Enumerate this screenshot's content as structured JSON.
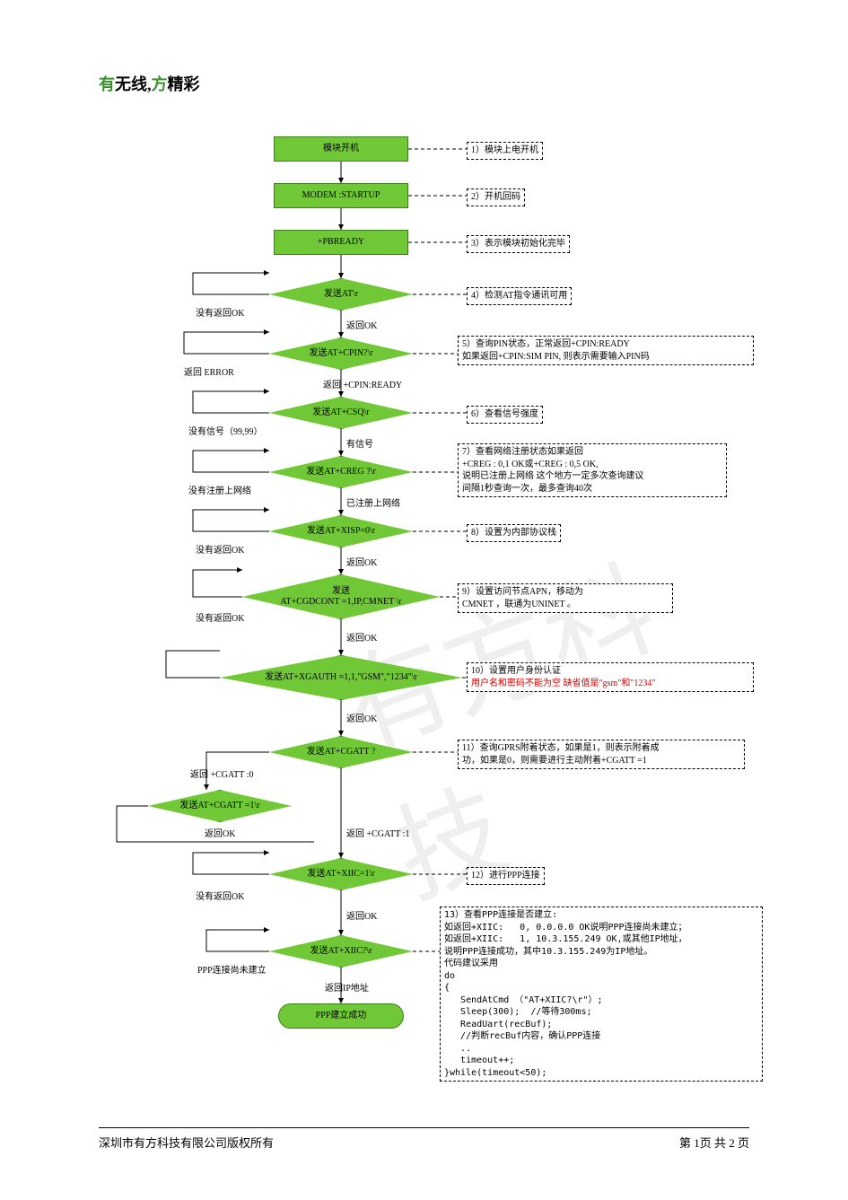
{
  "header": {
    "you": "有",
    "wuxian": "无线,",
    "fang": "方",
    "jingcai": "精彩"
  },
  "nodes": {
    "n1": "模块开机",
    "n2": "MODEM :STARTUP",
    "n3": "+PBREADY",
    "d4": "发送AT\\r",
    "d5": "发送AT+CPIN?\\r",
    "d6": "发送AT+CSQ\\r",
    "d7": "发送AT+CREG ?\\r",
    "d8": "发送AT+XISP=0\\r",
    "d9": "发送\nAT+CGDCONT =1,IP,CMNET \\r",
    "d10": "发送AT+XGAUTH =1,1,\"GSM\",\"1234\"\\r",
    "d11": "发送AT+CGATT ?",
    "d11b": "发送AT+CGATT =1\\r",
    "d12": "发送AT+XIIC=1\\r",
    "d13": "发送AT+XIIC?\\r",
    "n14": "PPP建立成功"
  },
  "labels": {
    "l4a": "没有返回OK",
    "l4b": "返回OK",
    "l5a": "返回 ERROR",
    "l5b": "返回 +CPIN:READY",
    "l6a": "没有信号（99,99）",
    "l6b": "有信号",
    "l7a": "没有注册上网络",
    "l7b": "已注册上网络",
    "l8a": "没有返回OK",
    "l8b": "返回OK",
    "l9a": "没有返回OK",
    "l9b": "返回OK",
    "l10b": "返回OK",
    "l11a": "返回 +CGATT :0",
    "l11b": "返回 +CGATT :1",
    "l11c": "返回OK",
    "l12a": "没有返回OK",
    "l12b": "返回OK",
    "l13a": "PPP连接尚未建立",
    "l13b": "返回IP地址"
  },
  "annots": {
    "a1": "1）模块上电开机",
    "a2": "2）开机回码",
    "a3": "3）表示模块初始化完毕",
    "a4": "4）检测AT指令通讯可用",
    "a5": "5）查询PIN状态，正常返回+CPIN:READY\n如果返回+CPIN:SIM PIN, 则表示需要输入PIN码",
    "a6": "6）查看信号强度",
    "a7": "7）查看网络注册状态如果返回\n+CREG : 0,1 OK或+CREG : 0,5 OK,\n说明已注册上网络 这个地方一定多次查询建议\n间隔1秒查询一次，最多查询40次",
    "a8": "8）设置为内部协议栈",
    "a9": "9）设置访问节点APN，移动为\nCMNET ，联通为UNINET 。",
    "a10_main": "10）设置用户身份认证",
    "a10_red": "用户名和密码不能为空 缺省值是\"gsm\"和\"1234\"",
    "a11": "11）查询GPRS附着状态，如果是1，则表示附着成\n功，如果是0，则需要进行主动附着+CGATT =1",
    "a12": "12）进行PPP连接",
    "a13": "13）查看PPP连接是否建立:\n如返回+XIIC:   0, 0.0.0.0 OK说明PPP连接尚未建立；\n如返回+XIIC:   1, 10.3.155.249 OK,或其他IP地址，\n说明PPP连接成功，其中10.3.155.249为IP地址。\n代码建议采用\ndo\n{\n   SendAtCmd （\"AT+XIIC?\\r\"）;\n   Sleep(300);  //等待300ms;\n   ReadUart(recBuf);\n   //判断recBuf内容，确认PPP连接\n   ..\n   timeout++;\n}while(timeout<50);"
  },
  "footer": {
    "left": "深圳市有方科技有限公司版权所有",
    "right": "第 1页 共 2 页"
  },
  "watermark": "有方科技"
}
